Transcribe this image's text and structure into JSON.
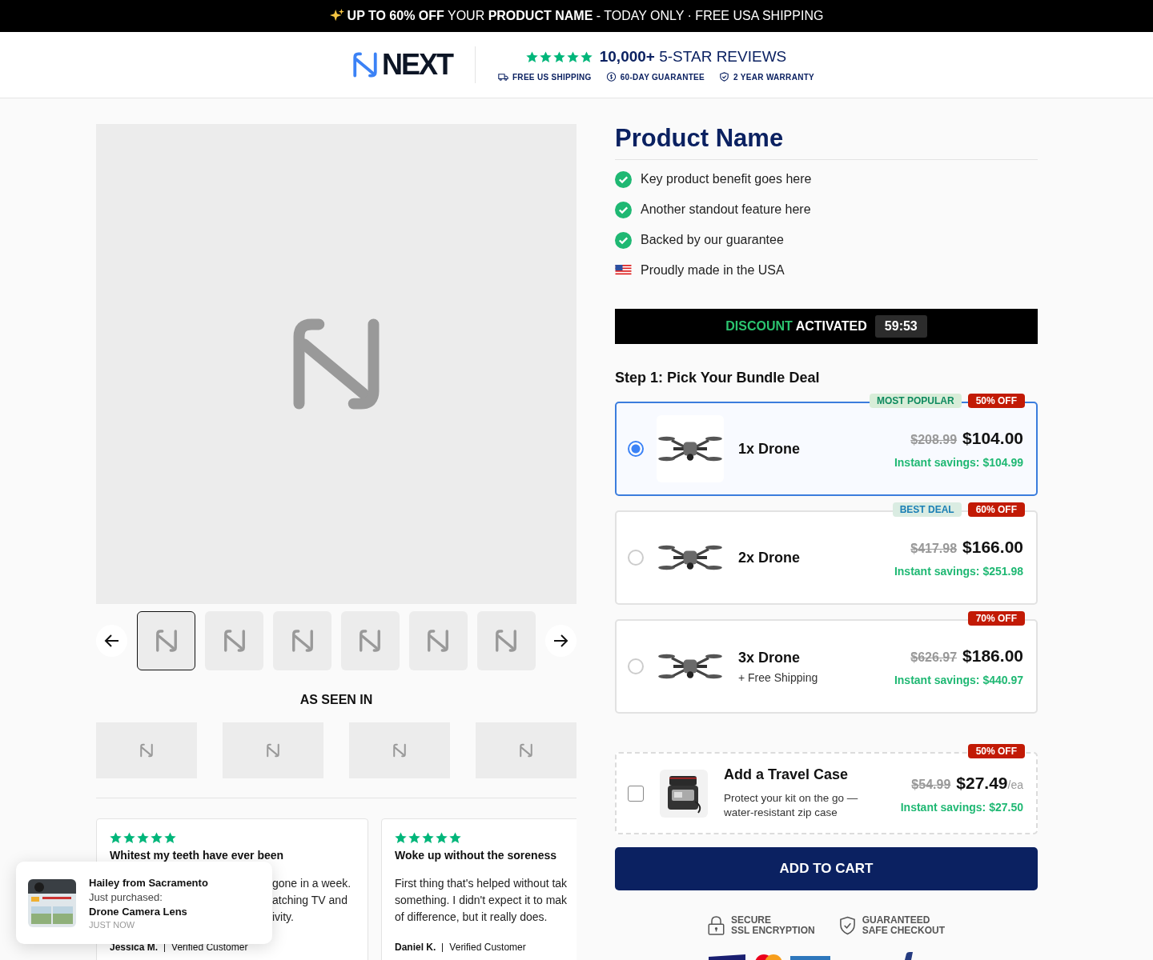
{
  "promo_bar": {
    "text": "**UP TO 60% OFF** YOUR **PRODUCT NAME** - TODAY ONLY · FREE USA SHIPPING"
  },
  "header": {
    "logo": "NEXT",
    "stars": 5,
    "reviews": "**10,000+** 5-STAR REVIEWS",
    "badges": [
      {
        "kind": "truck",
        "text": "FREE US SHIPPING"
      },
      {
        "kind": "coin",
        "text": "60-DAY GUARANTEE"
      },
      {
        "kind": "shield",
        "text": "2 YEAR WARRANTY"
      }
    ]
  },
  "gallery": {
    "thumbnails": [
      {
        "selected": true
      },
      {
        "selected": false
      },
      {
        "selected": false
      },
      {
        "selected": false
      },
      {
        "selected": false
      },
      {
        "selected": false
      }
    ]
  },
  "as_seen_in": {
    "title": "AS SEEN IN"
  },
  "reviews": [
    {
      "stars": 5,
      "title": "Whitest my teeth have ever been",
      "body_lines": [
        "gone in a week.",
        "atching TV and",
        "ivity."
      ],
      "author": "Jessica M.",
      "badge": "Verified Customer"
    },
    {
      "stars": 5,
      "title": "Woke up without the soreness",
      "body_lines": [
        "First thing that's helped without tak",
        "something. I didn't expect it to mak",
        "of difference, but it really does."
      ],
      "author": "Daniel K.",
      "badge": "Verified Customer"
    }
  ],
  "product": {
    "title": "Product Name",
    "benefits": [
      {
        "kind": "check",
        "text": "Key product benefit goes here"
      },
      {
        "kind": "check",
        "text": "Another standout feature here"
      },
      {
        "kind": "check",
        "text": "Backed by our guarantee"
      },
      {
        "kind": "flag",
        "text": "Proudly made in the USA"
      }
    ],
    "timer": {
      "highlight": "DISCOUNT",
      "label": "ACTIVATED",
      "time": "59:53"
    },
    "step_title": "Step 1: Pick Your Bundle Deal",
    "bundles": [
      {
        "selected": true,
        "name": "1x Drone",
        "tag": {
          "text": "MOST POPULAR",
          "color": "#0e8a5f"
        },
        "discount": "50% OFF",
        "old_price": "$208.99",
        "price": "$104.00",
        "savings": "Instant savings: $104.99"
      },
      {
        "selected": false,
        "name": "2x Drone",
        "tag": {
          "text": "BEST DEAL",
          "color": "#1a7fb5"
        },
        "discount": "60% OFF",
        "old_price": "$417.98",
        "price": "$166.00",
        "savings": "Instant savings: $251.98"
      },
      {
        "selected": false,
        "name": "3x Drone",
        "subtitle": "+ Free Shipping",
        "discount": "70% OFF",
        "old_price": "$626.97",
        "price": "$186.00",
        "savings": "Instant savings: $440.97"
      }
    ],
    "addon": {
      "checked": false,
      "title": "Add a Travel Case",
      "description": "Protect your kit on the go — water-resistant zip case",
      "discount": "50% OFF",
      "old_price": "$54.99",
      "price": "$27.49",
      "unit": "/ea",
      "savings": "Instant savings: $27.50"
    },
    "add_to_cart": "ADD TO CART",
    "trust": [
      {
        "kind": "lock",
        "lines": [
          "SECURE",
          "SSL ENCRYPTION"
        ]
      },
      {
        "kind": "shield",
        "lines": [
          "GUARANTEED",
          "SAFE CHECKOUT"
        ]
      }
    ]
  },
  "purchase_popup": {
    "name": "Hailey from Sacramento",
    "action": "Just purchased:",
    "product": "Drone Camera Lens",
    "time": "JUST NOW"
  }
}
